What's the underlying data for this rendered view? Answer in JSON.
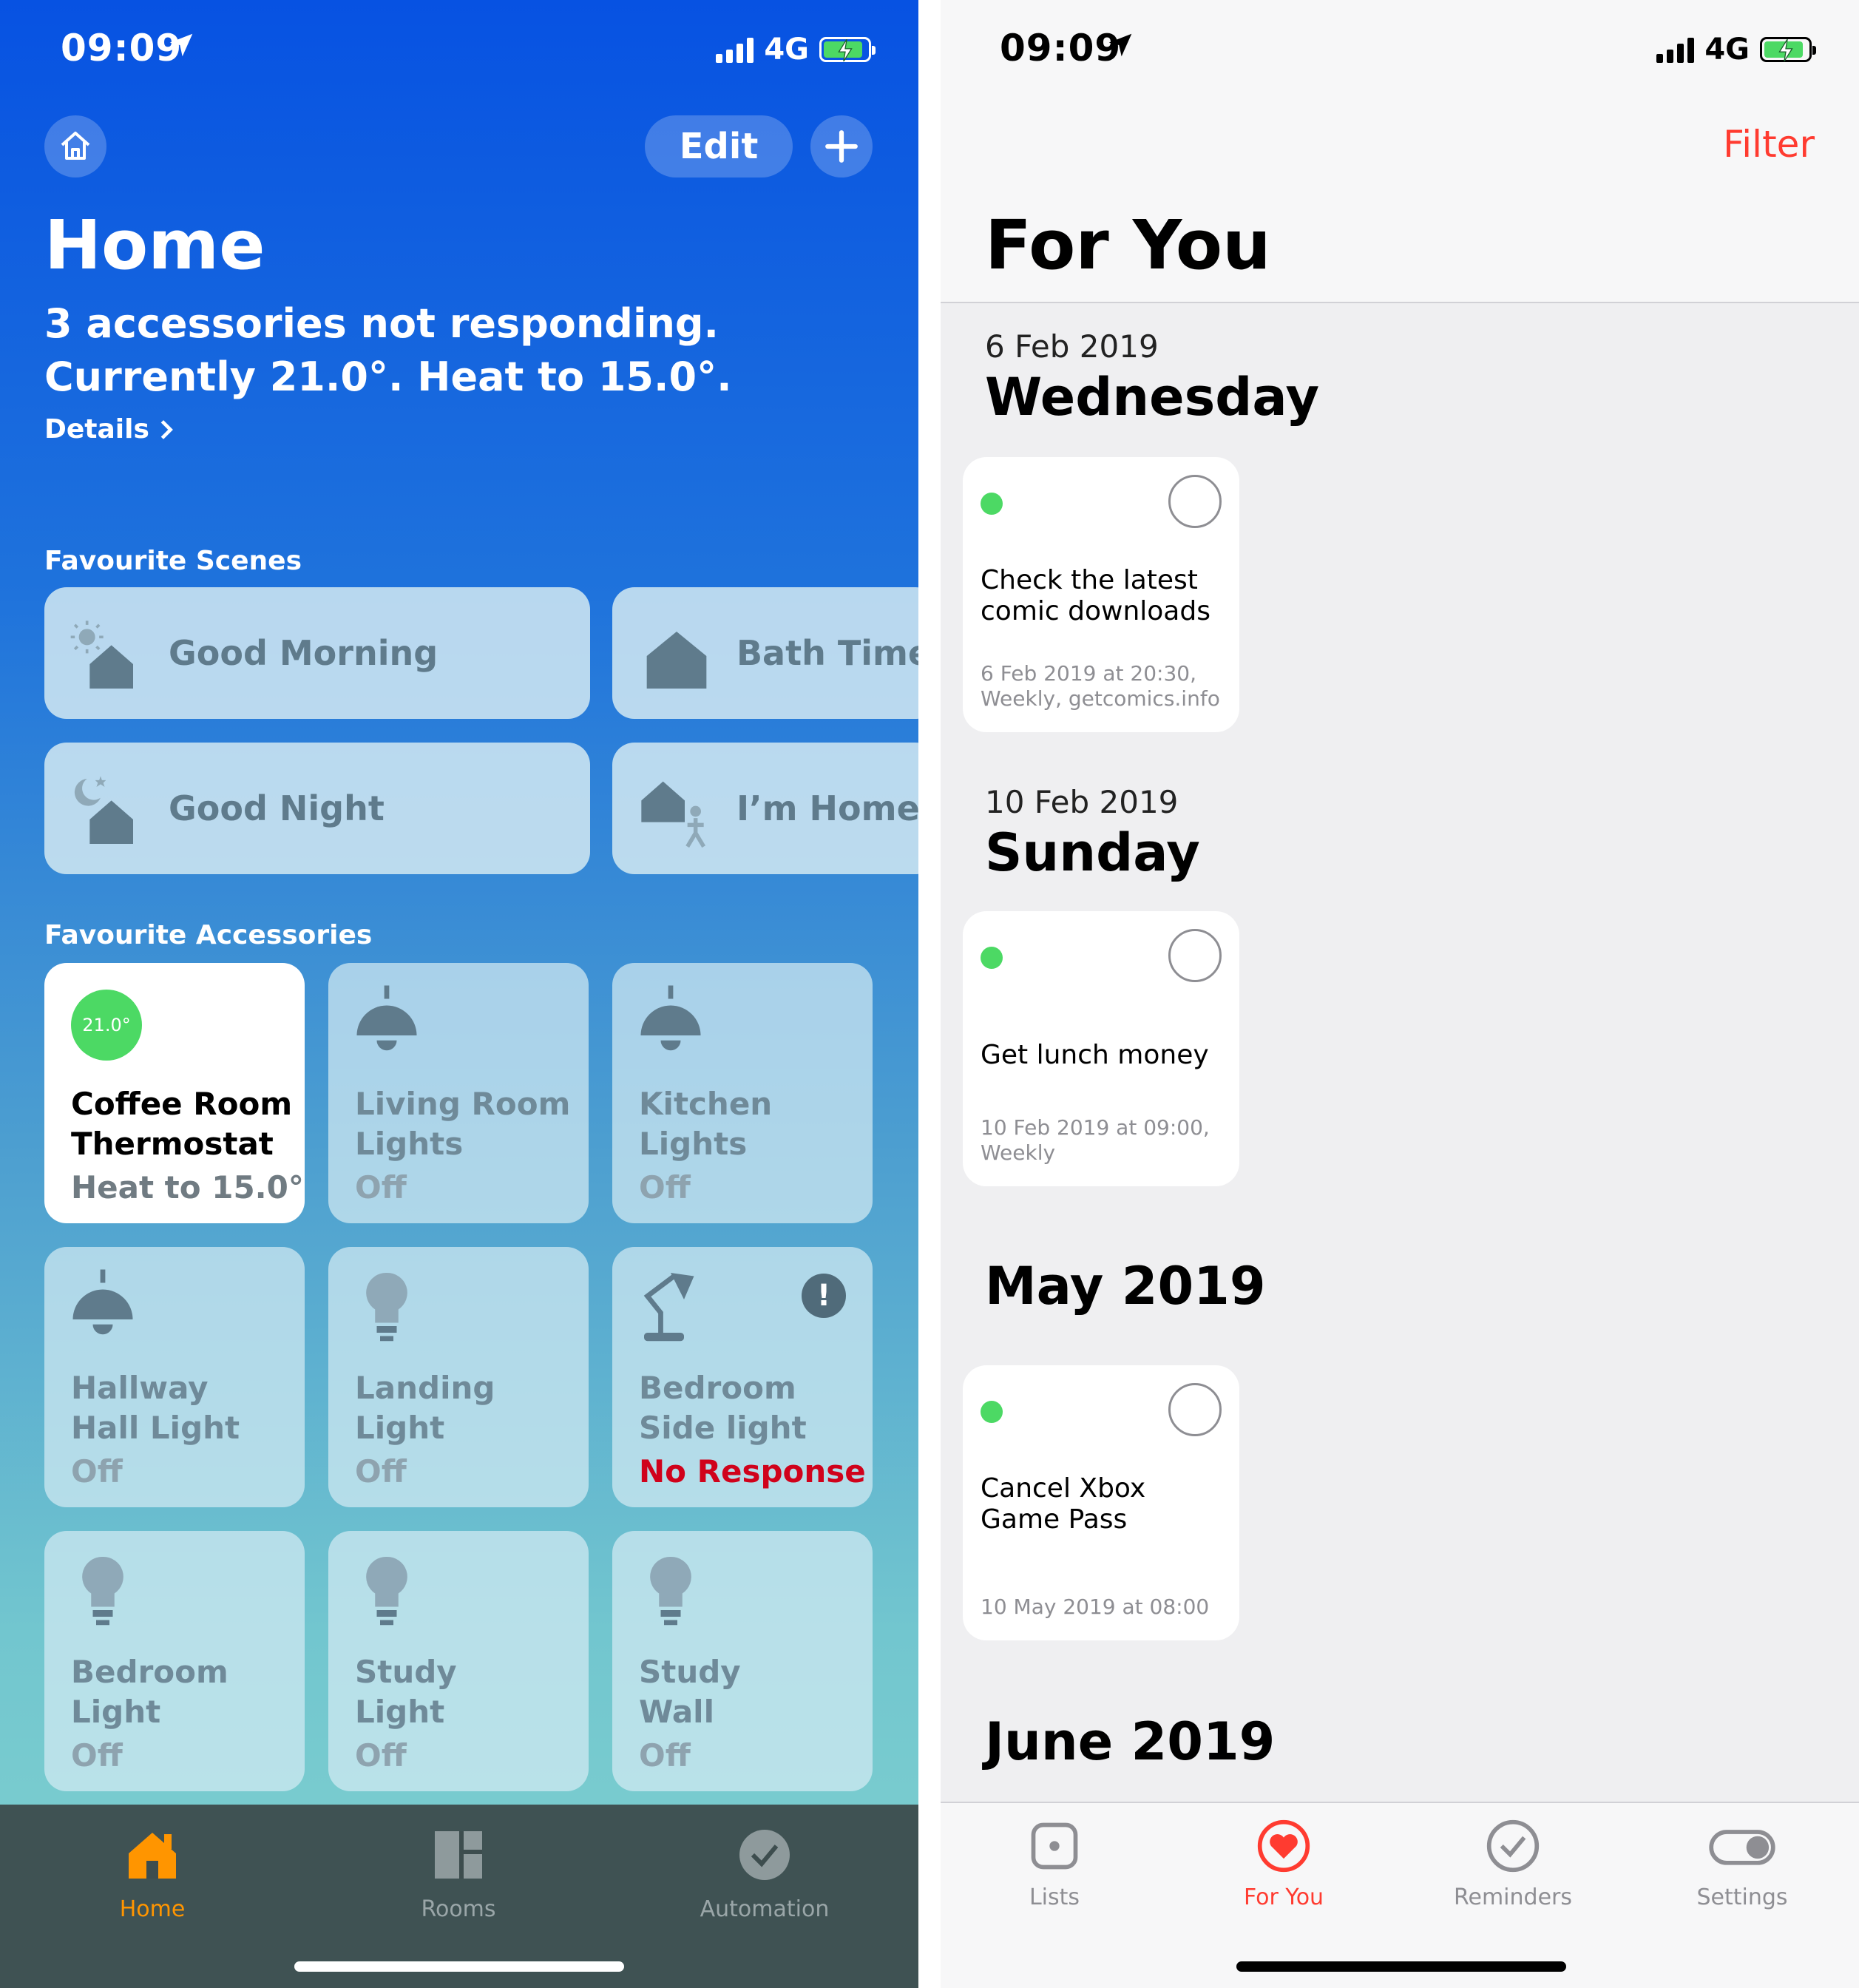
{
  "left": {
    "status": {
      "time": "09:09",
      "network": "4G"
    },
    "header": {
      "edit_label": "Edit"
    },
    "title": "Home",
    "summary_line1": "3 accessories not responding.",
    "summary_line2": "Currently 21.0°. Heat to 15.0°.",
    "details_label": "Details",
    "scenes_heading": "Favourite Scenes",
    "scenes": [
      {
        "label": "Good Morning",
        "icon": "sun-house-icon"
      },
      {
        "label": "Bath Time",
        "icon": "house-icon"
      },
      {
        "label": "Good Night",
        "icon": "moon-house-icon"
      },
      {
        "label": "I’m Home",
        "icon": "person-house-icon"
      }
    ],
    "accessories_heading": "Favourite Accessories",
    "accessories": [
      {
        "badge": "21.0°",
        "name1": "Coffee Room",
        "name2": "Thermostat",
        "state": "Heat to 15.0°",
        "icon": "thermostat-icon"
      },
      {
        "name1": "Living Room",
        "name2": "Lights",
        "state": "Off",
        "icon": "pendant-lamp-icon"
      },
      {
        "name1": "Kitchen",
        "name2": "Lights",
        "state": "Off",
        "icon": "pendant-lamp-icon"
      },
      {
        "name1": "Hallway",
        "name2": "Hall Light",
        "state": "Off",
        "icon": "pendant-lamp-icon"
      },
      {
        "name1": "Landing",
        "name2": "Light",
        "state": "Off",
        "icon": "bulb-icon"
      },
      {
        "name1": "Bedroom",
        "name2": "Side light",
        "state": "No Response",
        "icon": "desk-lamp-icon",
        "alert_glyph": "!"
      },
      {
        "name1": "Bedroom",
        "name2": "Light",
        "state": "Off",
        "icon": "bulb-icon"
      },
      {
        "name1": "Study",
        "name2": "Light",
        "state": "Off",
        "icon": "bulb-icon"
      },
      {
        "name1": "Study",
        "name2": "Wall",
        "state": "Off",
        "icon": "bulb-icon"
      }
    ],
    "tabs": [
      {
        "label": "Home",
        "icon": "home-tab-icon"
      },
      {
        "label": "Rooms",
        "icon": "rooms-tab-icon"
      },
      {
        "label": "Automation",
        "icon": "automation-tab-icon"
      }
    ],
    "colors": {
      "accent": "#ff9500",
      "alert": "#d0021b",
      "thermostat": "#4cd964"
    }
  },
  "right": {
    "status": {
      "time": "09:09",
      "network": "4G"
    },
    "filter_label": "Filter",
    "title": "For You",
    "sections": [
      {
        "date": "6 Feb 2019",
        "heading": "Wednesday",
        "card": {
          "title": "Check the latest comic downloads",
          "meta": "6 Feb 2019 at 20:30, Weekly, getcomics.info"
        }
      },
      {
        "date": "10 Feb 2019",
        "heading": "Sunday",
        "card": {
          "title": "Get lunch money",
          "meta": "10 Feb 2019 at 09:00, Weekly"
        }
      },
      {
        "heading": "May 2019",
        "card": {
          "title": "Cancel Xbox Game Pass",
          "meta": "10 May 2019 at 08:00"
        }
      },
      {
        "heading": "June 2019"
      }
    ],
    "tabs": [
      {
        "label": "Lists",
        "icon": "lists-tab-icon"
      },
      {
        "label": "For You",
        "icon": "heart-tab-icon"
      },
      {
        "label": "Reminders",
        "icon": "checkmark-tab-icon"
      },
      {
        "label": "Settings",
        "icon": "toggle-tab-icon"
      }
    ],
    "colors": {
      "accent": "#ff3b30",
      "dot": "#4cd964"
    }
  }
}
